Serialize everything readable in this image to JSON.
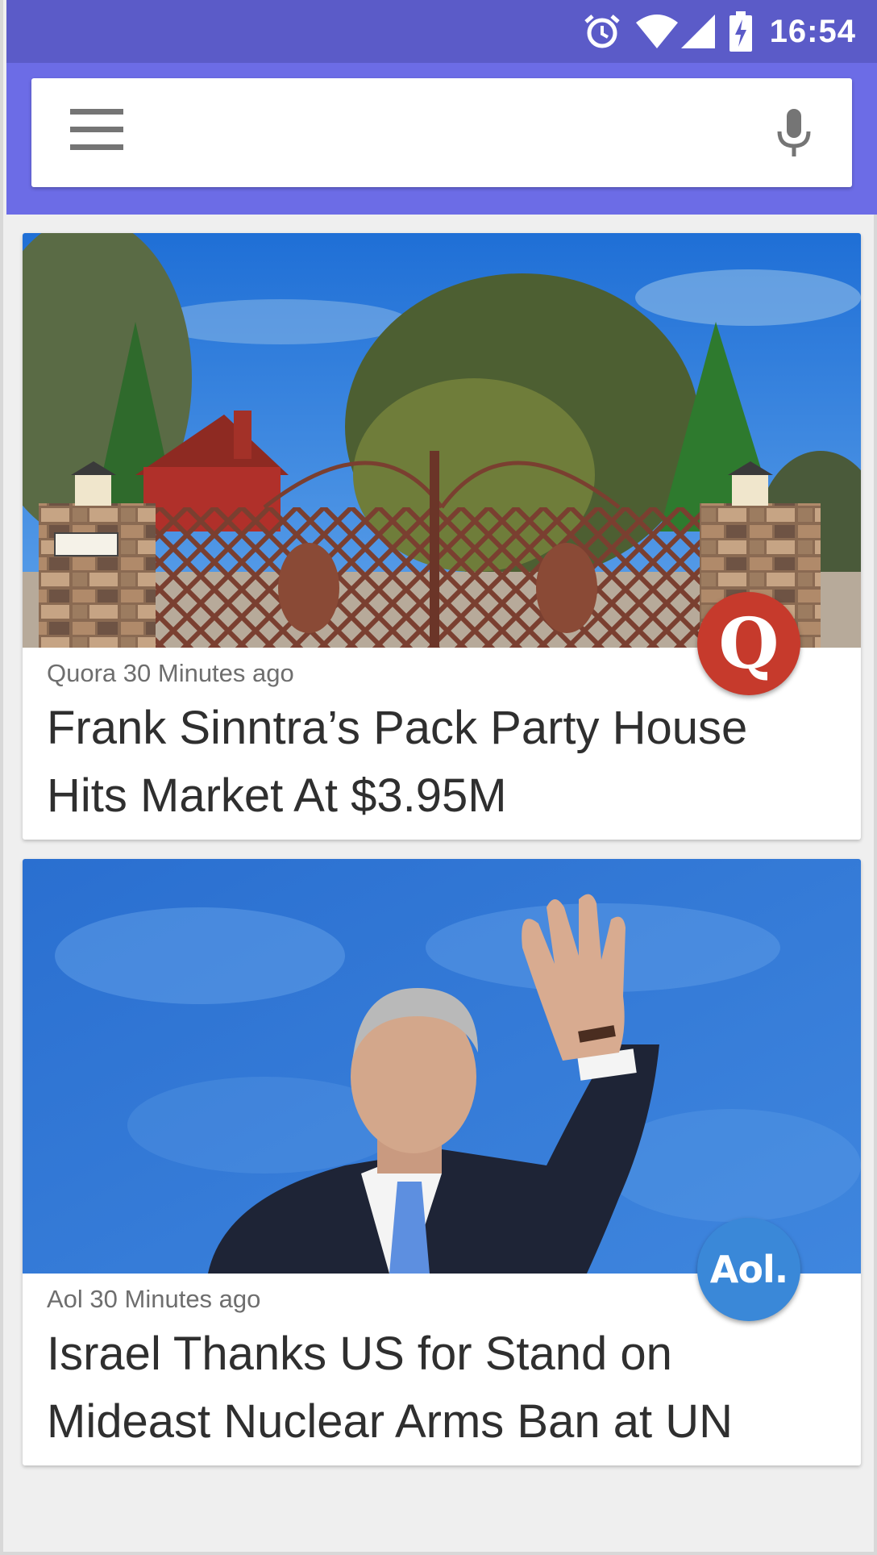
{
  "status_bar": {
    "time": "16:54",
    "icons": [
      "alarm-clock-icon",
      "wifi-icon",
      "cell-signal-icon",
      "battery-charging-icon"
    ]
  },
  "search": {
    "value": "",
    "placeholder": "",
    "menu_icon": "hamburger-menu-icon",
    "mic_icon": "microphone-icon"
  },
  "colors": {
    "status_bar": "#5b5bc8",
    "app_bar": "#6c6ce6",
    "quora_badge": "#c63a2c",
    "aol_badge": "#3a88d8",
    "background": "#efefef"
  },
  "feed": [
    {
      "source": "Quora",
      "time_ago": "30 Minutes ago",
      "meta": "Quora 30 Minutes ago",
      "title": "Frank Sinntra’s Pack Party House Hits Market At $3.95M",
      "badge_text": "Q",
      "image": "estate gate with stone pillars, red house and trees under blue sky"
    },
    {
      "source": "Aol",
      "time_ago": "30 Minutes ago",
      "meta": "Aol 30 Minutes ago",
      "title": "Israel Thanks US for Stand on Mideast Nuclear Arms Ban at UN",
      "badge_text": "Aol.",
      "image": "man in suit waving in front of blue backdrop"
    }
  ]
}
